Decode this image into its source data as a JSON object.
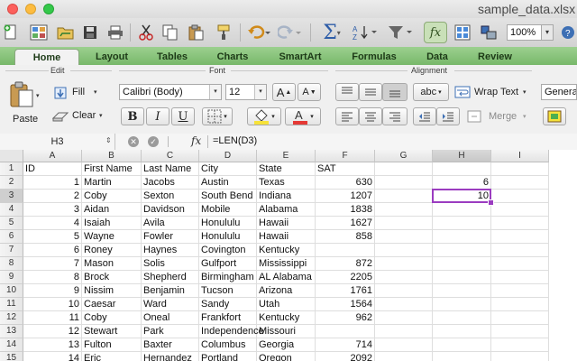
{
  "window": {
    "title": "sample_data.xlsx"
  },
  "toolbar": {
    "zoom": "100%"
  },
  "tabs": [
    "Home",
    "Layout",
    "Tables",
    "Charts",
    "SmartArt",
    "Formulas",
    "Data",
    "Review"
  ],
  "ribbon": {
    "edit_label": "Edit",
    "font_label": "Font",
    "alignment_label": "Alignment",
    "paste": "Paste",
    "fill": "Fill",
    "clear": "Clear",
    "font_name": "Calibri (Body)",
    "font_size": "12",
    "bold": "B",
    "italic": "I",
    "underline": "U",
    "grow": "A",
    "shrink": "A",
    "orientation": "abc",
    "wrap_text": "Wrap Text",
    "merge": "Merge",
    "number_format": "General"
  },
  "formula_bar": {
    "name_box": "H3",
    "fx": "fx",
    "formula": "=LEN(D3)"
  },
  "columns": [
    "A",
    "B",
    "C",
    "D",
    "E",
    "F",
    "G",
    "H",
    "I"
  ],
  "rows": [
    {
      "n": "1",
      "A": "ID",
      "B": "First Name",
      "C": "Last Name",
      "D": "City",
      "E": "State",
      "F": "SAT",
      "H": ""
    },
    {
      "n": "2",
      "A": "1",
      "B": "Martin",
      "C": "Jacobs",
      "D": "Austin",
      "E": "Texas",
      "F": "630",
      "H": "6"
    },
    {
      "n": "3",
      "A": "2",
      "B": "Coby",
      "C": "Sexton",
      "D": "South Bend",
      "E": "Indiana",
      "F": "1207",
      "H": "10"
    },
    {
      "n": "4",
      "A": "3",
      "B": "Aidan",
      "C": "Davidson",
      "D": "Mobile",
      "E": "Alabama",
      "F": "1838",
      "H": ""
    },
    {
      "n": "5",
      "A": "4",
      "B": "Isaiah",
      "C": "Avila",
      "D": "Honululu",
      "E": "Hawaii",
      "F": "1627",
      "H": ""
    },
    {
      "n": "6",
      "A": "5",
      "B": "Wayne",
      "C": "Fowler",
      "D": "Honululu",
      "E": "Hawaii",
      "F": "858",
      "H": ""
    },
    {
      "n": "7",
      "A": "6",
      "B": "Roney",
      "C": "Haynes",
      "D": "Covington",
      "E": "Kentucky",
      "F": "",
      "H": ""
    },
    {
      "n": "8",
      "A": "7",
      "B": "Mason",
      "C": "Solis",
      "D": "Gulfport",
      "E": "Mississippi",
      "F": "872",
      "H": ""
    },
    {
      "n": "9",
      "A": "8",
      "B": "Brock",
      "C": "Shepherd",
      "D": "Birmingham",
      "E": "AL Alabama",
      "F": "2205",
      "H": ""
    },
    {
      "n": "10",
      "A": "9",
      "B": "Nissim",
      "C": "Benjamin",
      "D": "Tucson",
      "E": "Arizona",
      "F": "1761",
      "H": ""
    },
    {
      "n": "11",
      "A": "10",
      "B": "Caesar",
      "C": "Ward",
      "D": "Sandy",
      "E": "Utah",
      "F": "1564",
      "H": ""
    },
    {
      "n": "12",
      "A": "11",
      "B": "Coby",
      "C": "Oneal",
      "D": "Frankfort",
      "E": "Kentucky",
      "F": "962",
      "H": ""
    },
    {
      "n": "13",
      "A": "12",
      "B": "Stewart",
      "C": "Park",
      "D": "Independence",
      "E": "Missouri",
      "F": "",
      "H": ""
    },
    {
      "n": "14",
      "A": "13",
      "B": "Fulton",
      "C": "Baxter",
      "D": "Columbus",
      "E": "Georgia",
      "F": "714",
      "H": ""
    },
    {
      "n": "15",
      "A": "14",
      "B": "Eric",
      "C": "Hernandez",
      "D": "Portland",
      "E": "Oregon",
      "F": "2092",
      "H": ""
    }
  ],
  "selection": {
    "cell": "H3"
  }
}
